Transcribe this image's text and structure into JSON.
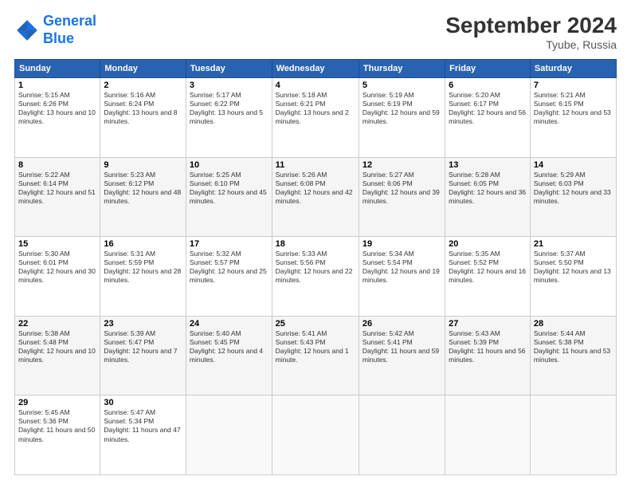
{
  "logo": {
    "line1": "General",
    "line2": "Blue"
  },
  "title": "September 2024",
  "location": "Tyube, Russia",
  "weekdays": [
    "Sunday",
    "Monday",
    "Tuesday",
    "Wednesday",
    "Thursday",
    "Friday",
    "Saturday"
  ],
  "weeks": [
    [
      {
        "day": "1",
        "sunrise": "Sunrise: 5:15 AM",
        "sunset": "Sunset: 6:26 PM",
        "daylight": "Daylight: 13 hours and 10 minutes."
      },
      {
        "day": "2",
        "sunrise": "Sunrise: 5:16 AM",
        "sunset": "Sunset: 6:24 PM",
        "daylight": "Daylight: 13 hours and 8 minutes."
      },
      {
        "day": "3",
        "sunrise": "Sunrise: 5:17 AM",
        "sunset": "Sunset: 6:22 PM",
        "daylight": "Daylight: 13 hours and 5 minutes."
      },
      {
        "day": "4",
        "sunrise": "Sunrise: 5:18 AM",
        "sunset": "Sunset: 6:21 PM",
        "daylight": "Daylight: 13 hours and 2 minutes."
      },
      {
        "day": "5",
        "sunrise": "Sunrise: 5:19 AM",
        "sunset": "Sunset: 6:19 PM",
        "daylight": "Daylight: 12 hours and 59 minutes."
      },
      {
        "day": "6",
        "sunrise": "Sunrise: 5:20 AM",
        "sunset": "Sunset: 6:17 PM",
        "daylight": "Daylight: 12 hours and 56 minutes."
      },
      {
        "day": "7",
        "sunrise": "Sunrise: 5:21 AM",
        "sunset": "Sunset: 6:15 PM",
        "daylight": "Daylight: 12 hours and 53 minutes."
      }
    ],
    [
      {
        "day": "8",
        "sunrise": "Sunrise: 5:22 AM",
        "sunset": "Sunset: 6:14 PM",
        "daylight": "Daylight: 12 hours and 51 minutes."
      },
      {
        "day": "9",
        "sunrise": "Sunrise: 5:23 AM",
        "sunset": "Sunset: 6:12 PM",
        "daylight": "Daylight: 12 hours and 48 minutes."
      },
      {
        "day": "10",
        "sunrise": "Sunrise: 5:25 AM",
        "sunset": "Sunset: 6:10 PM",
        "daylight": "Daylight: 12 hours and 45 minutes."
      },
      {
        "day": "11",
        "sunrise": "Sunrise: 5:26 AM",
        "sunset": "Sunset: 6:08 PM",
        "daylight": "Daylight: 12 hours and 42 minutes."
      },
      {
        "day": "12",
        "sunrise": "Sunrise: 5:27 AM",
        "sunset": "Sunset: 6:06 PM",
        "daylight": "Daylight: 12 hours and 39 minutes."
      },
      {
        "day": "13",
        "sunrise": "Sunrise: 5:28 AM",
        "sunset": "Sunset: 6:05 PM",
        "daylight": "Daylight: 12 hours and 36 minutes."
      },
      {
        "day": "14",
        "sunrise": "Sunrise: 5:29 AM",
        "sunset": "Sunset: 6:03 PM",
        "daylight": "Daylight: 12 hours and 33 minutes."
      }
    ],
    [
      {
        "day": "15",
        "sunrise": "Sunrise: 5:30 AM",
        "sunset": "Sunset: 6:01 PM",
        "daylight": "Daylight: 12 hours and 30 minutes."
      },
      {
        "day": "16",
        "sunrise": "Sunrise: 5:31 AM",
        "sunset": "Sunset: 5:59 PM",
        "daylight": "Daylight: 12 hours and 28 minutes."
      },
      {
        "day": "17",
        "sunrise": "Sunrise: 5:32 AM",
        "sunset": "Sunset: 5:57 PM",
        "daylight": "Daylight: 12 hours and 25 minutes."
      },
      {
        "day": "18",
        "sunrise": "Sunrise: 5:33 AM",
        "sunset": "Sunset: 5:56 PM",
        "daylight": "Daylight: 12 hours and 22 minutes."
      },
      {
        "day": "19",
        "sunrise": "Sunrise: 5:34 AM",
        "sunset": "Sunset: 5:54 PM",
        "daylight": "Daylight: 12 hours and 19 minutes."
      },
      {
        "day": "20",
        "sunrise": "Sunrise: 5:35 AM",
        "sunset": "Sunset: 5:52 PM",
        "daylight": "Daylight: 12 hours and 16 minutes."
      },
      {
        "day": "21",
        "sunrise": "Sunrise: 5:37 AM",
        "sunset": "Sunset: 5:50 PM",
        "daylight": "Daylight: 12 hours and 13 minutes."
      }
    ],
    [
      {
        "day": "22",
        "sunrise": "Sunrise: 5:38 AM",
        "sunset": "Sunset: 5:48 PM",
        "daylight": "Daylight: 12 hours and 10 minutes."
      },
      {
        "day": "23",
        "sunrise": "Sunrise: 5:39 AM",
        "sunset": "Sunset: 5:47 PM",
        "daylight": "Daylight: 12 hours and 7 minutes."
      },
      {
        "day": "24",
        "sunrise": "Sunrise: 5:40 AM",
        "sunset": "Sunset: 5:45 PM",
        "daylight": "Daylight: 12 hours and 4 minutes."
      },
      {
        "day": "25",
        "sunrise": "Sunrise: 5:41 AM",
        "sunset": "Sunset: 5:43 PM",
        "daylight": "Daylight: 12 hours and 1 minute."
      },
      {
        "day": "26",
        "sunrise": "Sunrise: 5:42 AM",
        "sunset": "Sunset: 5:41 PM",
        "daylight": "Daylight: 11 hours and 59 minutes."
      },
      {
        "day": "27",
        "sunrise": "Sunrise: 5:43 AM",
        "sunset": "Sunset: 5:39 PM",
        "daylight": "Daylight: 11 hours and 56 minutes."
      },
      {
        "day": "28",
        "sunrise": "Sunrise: 5:44 AM",
        "sunset": "Sunset: 5:38 PM",
        "daylight": "Daylight: 11 hours and 53 minutes."
      }
    ],
    [
      {
        "day": "29",
        "sunrise": "Sunrise: 5:45 AM",
        "sunset": "Sunset: 5:36 PM",
        "daylight": "Daylight: 11 hours and 50 minutes."
      },
      {
        "day": "30",
        "sunrise": "Sunrise: 5:47 AM",
        "sunset": "Sunset: 5:34 PM",
        "daylight": "Daylight: 11 hours and 47 minutes."
      },
      null,
      null,
      null,
      null,
      null
    ]
  ]
}
